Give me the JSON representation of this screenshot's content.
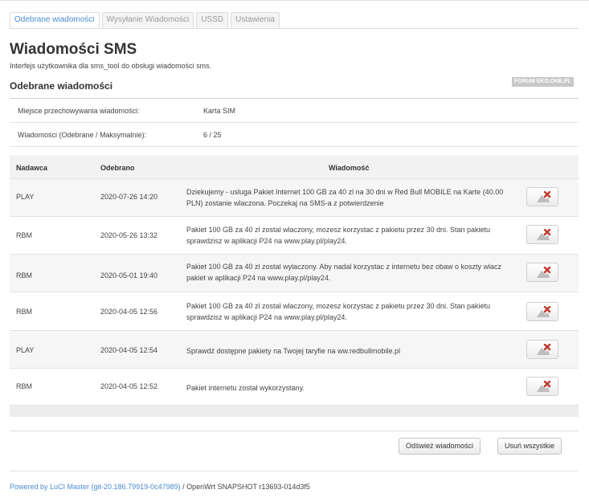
{
  "tabs": [
    {
      "label": "Odebrane wiadomości",
      "active": true
    },
    {
      "label": "Wysyłanie Wiadomości",
      "active": false
    },
    {
      "label": "USSD",
      "active": false
    },
    {
      "label": "Ustawienia",
      "active": false
    }
  ],
  "page": {
    "title": "Wiadomości SMS",
    "description": "Interfejs użytkownika dla sms_tool do obsługi wiadomości sms.",
    "section_title": "Odebrane wiadomości",
    "badge": "FORUM EKO.ONE.PL"
  },
  "info": {
    "storage_label": "Miejsce przechowywania wiadomości:",
    "storage_value": "Karta SIM",
    "count_label": "Wiadomości (Odebrane / Maksymalnie):",
    "count_value": "6 / 25"
  },
  "table": {
    "headers": {
      "sender": "Nadawca",
      "date": "Odebrano",
      "message": "Wiadomość"
    },
    "rows": [
      {
        "sender": "PLAY",
        "date": "2020-07-26 14:20",
        "message": "Dziekujemy - usluga Pakiet Internet 100 GB za 40 zl na 30 dni w Red Bull MOBILE na Karte (40.00 PLN) zostanie wlaczona. Poczekaj na SMS-a z potwierdzenie"
      },
      {
        "sender": "RBM",
        "date": "2020-05-26 13:32",
        "message": "Pakiet 100 GB za 40 zl zostal wlaczony, mozesz korzystac z pakietu przez 30 dni. Stan pakietu sprawdzisz w aplikacji P24 na www.play.pl/play24."
      },
      {
        "sender": "RBM",
        "date": "2020-05-01 19:40",
        "message": "Pakiet 100 GB za 40 zl zostal wylaczony. Aby nadal korzystac z internetu bez obaw o koszty wlacz pakiet w aplikacji P24 na www.play.pl/play24."
      },
      {
        "sender": "RBM",
        "date": "2020-04-05 12:56",
        "message": "Pakiet 100 GB za 40 zl zostal wlaczony, mozesz korzystac z pakietu przez 30 dni. Stan pakietu sprawdzisz w aplikacji P24 na www.play.pl/play24."
      },
      {
        "sender": "PLAY",
        "date": "2020-04-05 12:54",
        "message": "Sprawdź dostępne pakiety na Twojej taryfie na ww.redbullmobile.pl"
      },
      {
        "sender": "RBM",
        "date": "2020-04-05 12:52",
        "message": "Pakiet internetu został wykorzystany."
      }
    ]
  },
  "buttons": {
    "refresh": "Odśwież wiadomości",
    "delete_all": "Usuń wszystkie"
  },
  "footer": {
    "link_text": "Powered by LuCI Master (git-20.186.79919-0c47989)",
    "suffix": " / OpenWrt SNAPSHOT r13693-014d3f5"
  },
  "colors": {
    "accent": "#4a8bd1",
    "delete_x": "#c0392b",
    "icon_grey": "#bdbdbd"
  },
  "icons": {
    "row_action": "delete-message-icon"
  }
}
